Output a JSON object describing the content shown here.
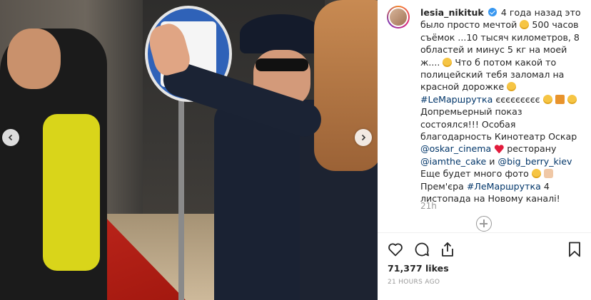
{
  "post": {
    "username": "lesia_nikituk",
    "caption": {
      "part1": " 4 года назад это было просто мечтой",
      "part2": "500 часов съёмок ...10 тысяч километров, 8 областей и минус 5 кг на моей ж.... ",
      "part3": "Что б потом какой то полицейский тебя заломал на красной дорожке ",
      "hashtag1": "#LeМаршрутка",
      "part4": " єєєєєєєєє",
      "part5": " Допремьерный показ состоялся!!! Особая благодарность Кинотеатр Оскар ",
      "mention1": "@oskar_cinema",
      "part6": " ресторану ",
      "mention2": "@iamthe_cake",
      "part7": " и ",
      "mention3": "@big_berry_kiev",
      "part8": " Еще будет много фото",
      "part9": " Прем'єра ",
      "hashtag2": "#ЛеМаршрутка",
      "part10": " 4 листопада на Новому каналі!"
    },
    "comment_time": "21h",
    "likes": "71,377 likes",
    "posted_ago": "21 HOURS AGO"
  },
  "icons": {
    "verified": "verified-badge-icon",
    "like": "heart-outline-icon",
    "comment": "speech-bubble-icon",
    "share": "share-upload-icon",
    "save": "bookmark-icon",
    "load_more": "plus-circle-icon",
    "prev": "chevron-left-icon",
    "next": "chevron-right-icon"
  },
  "colors": {
    "text": "#262626",
    "link": "#003569",
    "muted": "#999999",
    "verified": "#3897f0",
    "heart": "#e21b3c"
  }
}
